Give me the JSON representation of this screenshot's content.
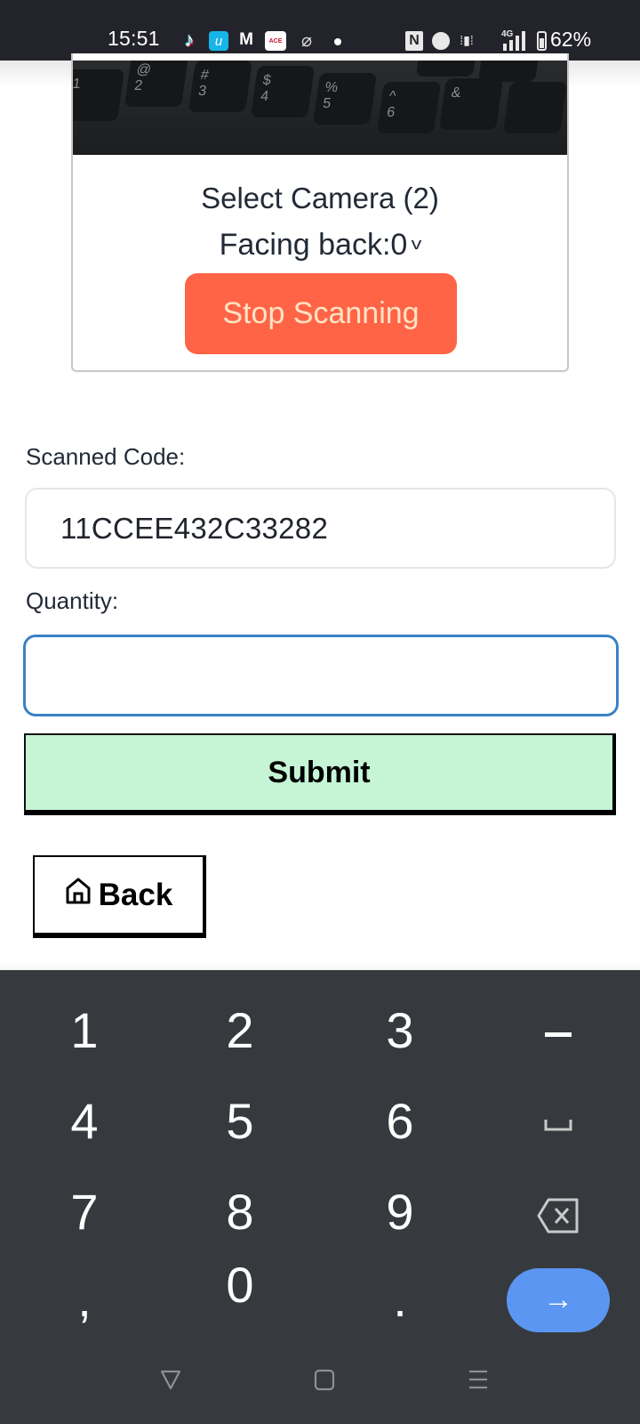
{
  "status_bar": {
    "time": "15:51",
    "notification_icons": [
      "tiktok-icon",
      "u-app-icon",
      "gmail-icon",
      "ace-app-icon",
      "phi-app-icon",
      "more-dot-icon"
    ],
    "system_icons": [
      "nfc-icon",
      "alarm-icon",
      "vibrate-icon",
      "signal-4g-icon",
      "battery-icon"
    ],
    "network": "4G",
    "battery": "62%"
  },
  "scanner": {
    "camera_feed_keys": [
      "1",
      "2",
      "3",
      "4",
      "5",
      "6",
      "@",
      "#",
      "$",
      "%",
      "^",
      "&"
    ],
    "select_camera_label": "Select Camera (2)",
    "camera_selected": "Facing back:0",
    "stop_button_label": "Stop Scanning",
    "colors": {
      "stop_button": "#ff6447",
      "stop_text": "#ffe3c4"
    }
  },
  "form": {
    "scanned_code_label": "Scanned Code:",
    "scanned_code_value": "11CCEE432C33282",
    "quantity_label": "Quantity:",
    "quantity_value": "",
    "submit_label": "Submit",
    "back_label": "Back",
    "colors": {
      "submit_bg": "#c6f5d6",
      "focus_border": "#3b82c4"
    }
  },
  "keyboard": {
    "rows": [
      [
        "1",
        "2",
        "3",
        "–"
      ],
      [
        "4",
        "5",
        "6",
        "␣"
      ],
      [
        "7",
        "8",
        "9",
        "⌫"
      ],
      [
        ",",
        "0",
        ".",
        "→"
      ]
    ],
    "enter_color": "#5b96f2"
  },
  "nav_bar": {
    "buttons": [
      "back-triangle-icon",
      "home-square-icon",
      "recents-menu-icon"
    ]
  }
}
